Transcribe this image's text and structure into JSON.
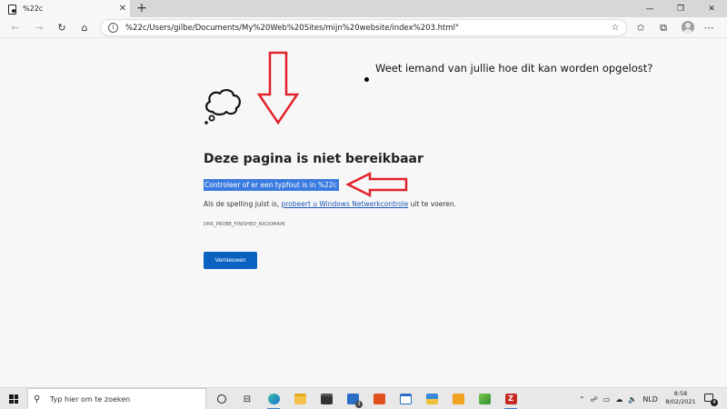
{
  "browser": {
    "tab": {
      "title": "%22c"
    },
    "new_tab_symbol": "+",
    "window_buttons": [
      "—",
      "❐",
      "✕"
    ],
    "address": {
      "url": "%22c/Users/gilbe/Documents/My%20Web%20Sites/mijn%20website/index%203.html\""
    },
    "icons": [
      "back-icon",
      "forward-icon",
      "refresh-icon",
      "home-icon",
      "info-icon",
      "star-icon",
      "favorites-icon",
      "collections-icon",
      "profile-icon",
      "more-icon"
    ]
  },
  "page": {
    "question": "Weet iemand van jullie hoe dit kan worden opgelost?",
    "heading": "Deze pagina is niet bereikbaar",
    "selected_text": "Controleer of er een typfout is in %22c",
    "hint_before": "Als de spelling juist is, ",
    "hint_link": "probeert u Windows Netwerkcontrole",
    "hint_after": " uit te voeren.",
    "error_code": "DNS_PROBE_FINISHED_NXDOMAIN",
    "reload_label": "Vernieuwen",
    "annotation_color": "#e2222a"
  },
  "taskbar": {
    "search_placeholder": "Typ hier om te zoeken",
    "mail_badge": "3",
    "language": "NLD",
    "time": "8:58",
    "date": "8/02/2021",
    "notification_count": "4",
    "accent": "#3b78d8"
  }
}
